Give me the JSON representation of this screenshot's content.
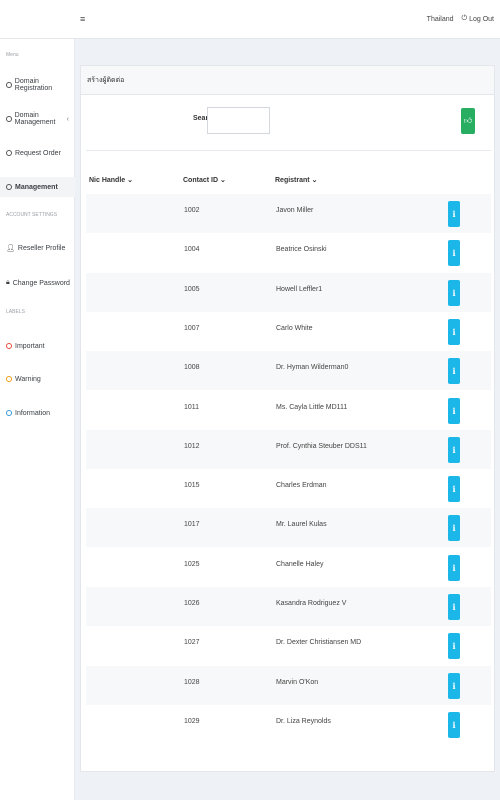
{
  "topbar": {
    "menu_icon": "hamburger-icon",
    "language": "Thailand",
    "logout_icon": "power-icon",
    "logout_label": "Log Out"
  },
  "sidebar": {
    "menu_header": "Menu",
    "items": [
      {
        "label": "Domain Registration",
        "icon": "circle-icon"
      },
      {
        "label": "Domain Management",
        "icon": "circle-icon",
        "chevron": "‹"
      },
      {
        "label": "Request Order",
        "icon": "circle-icon"
      },
      {
        "label": "Management",
        "icon": "circle-icon"
      }
    ],
    "account_header": "ACCOUNT SETTINGS",
    "account_items": [
      {
        "label": "Reseller Profile",
        "icon": "user-icon"
      },
      {
        "label": "Change Password",
        "icon": "lock-icon"
      }
    ],
    "labels_header": "LABELS",
    "label_items": [
      {
        "label": "Important",
        "color": "#e74c3c"
      },
      {
        "label": "Warning",
        "color": "#f39c12"
      },
      {
        "label": "Information",
        "color": "#3498db"
      }
    ]
  },
  "panel": {
    "title": "สร้างผู้ติดต่อ",
    "search_label": "Search",
    "search_value": "",
    "add_icon": "thumbs-up-icon"
  },
  "table": {
    "headers": [
      "Nic Handle",
      "Contact ID",
      "Registrant"
    ],
    "sort_icon": "chevron-down-icon",
    "rows": [
      {
        "nic": "",
        "id": "1002",
        "name": "Javon Miller"
      },
      {
        "nic": "",
        "id": "1004",
        "name": "Beatrice Osinski"
      },
      {
        "nic": "",
        "id": "1005",
        "name": "Howell Leffler1"
      },
      {
        "nic": "",
        "id": "1007",
        "name": "Carlo White"
      },
      {
        "nic": "",
        "id": "1008",
        "name": "Dr. Hyman Wilderman0"
      },
      {
        "nic": "",
        "id": "1011",
        "name": "Ms. Cayla Little MD111"
      },
      {
        "nic": "",
        "id": "1012",
        "name": "Prof. Cynthia Steuber DDS11"
      },
      {
        "nic": "",
        "id": "1015",
        "name": "Charles Erdman"
      },
      {
        "nic": "",
        "id": "1017",
        "name": "Mr. Laurel Kulas"
      },
      {
        "nic": "",
        "id": "1025",
        "name": "Chanelle Haley"
      },
      {
        "nic": "",
        "id": "1026",
        "name": "Kasandra Rodriguez V"
      },
      {
        "nic": "",
        "id": "1027",
        "name": "Dr. Dexter Christiansen MD"
      },
      {
        "nic": "",
        "id": "1028",
        "name": "Marvin O'Kon"
      },
      {
        "nic": "",
        "id": "1029",
        "name": "Dr. Liza Reynolds"
      }
    ],
    "action_icon": "info-icon",
    "action_glyph": "i"
  }
}
